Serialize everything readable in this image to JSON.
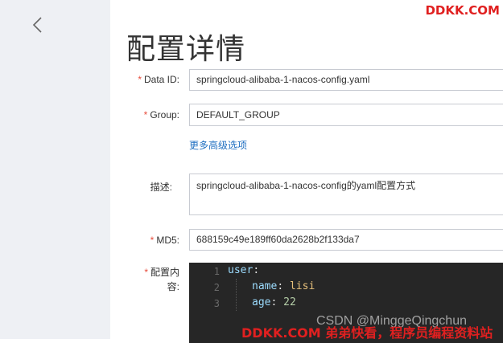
{
  "watermark_top": "DDKK.COM",
  "page_title": "配置详情",
  "form": {
    "data_id": {
      "label": "Data ID:",
      "value": "springcloud-alibaba-1-nacos-config.yaml"
    },
    "group": {
      "label": "Group:",
      "value": "DEFAULT_GROUP"
    },
    "more_options_link": "更多高级选项",
    "description": {
      "label": "描述:",
      "value": "springcloud-alibaba-1-nacos-config的yaml配置方式"
    },
    "md5": {
      "label": "MD5:",
      "value": "688159c49e189ff60da2628b2f133da7"
    },
    "content": {
      "label_line1": "配置内",
      "label_line2": "容:"
    },
    "required_marker": "*"
  },
  "editor": {
    "lines": [
      {
        "num": "1",
        "key": "user",
        "sep": ":",
        "val": ""
      },
      {
        "num": "2",
        "key": "name",
        "sep": ": ",
        "val": "lisi"
      },
      {
        "num": "3",
        "key": "age",
        "sep": ": ",
        "val": "22"
      }
    ]
  },
  "watermark_csdn": "CSDN @MinggeQingchun",
  "watermark_bottom": "DDKK.COM 弟弟快看，程序员编程资料站"
}
